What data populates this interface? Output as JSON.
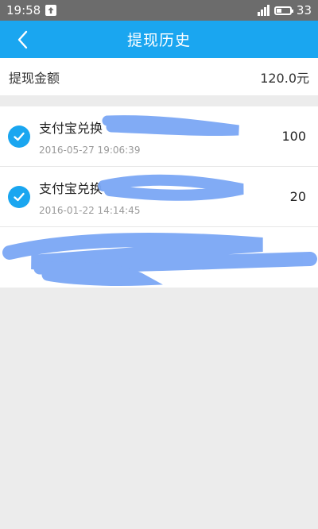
{
  "status_bar": {
    "time": "19:58",
    "battery_level": "33"
  },
  "nav": {
    "title": "提现历史",
    "back_icon": "chevron-left-icon"
  },
  "summary": {
    "label": "提现金额",
    "value": "120.0元"
  },
  "records": [
    {
      "title": "支付宝兑换",
      "date": "2016-05-27 19:06:39",
      "amount": "100"
    },
    {
      "title": "支付宝兑换",
      "date": "2016-01-22 14:14:45",
      "amount": "20"
    },
    {
      "title": "",
      "date": "",
      "amount": ""
    }
  ],
  "colors": {
    "accent": "#1aa6f0",
    "redaction": "#7ba7f5",
    "status_bar": "#6c6c6c"
  }
}
